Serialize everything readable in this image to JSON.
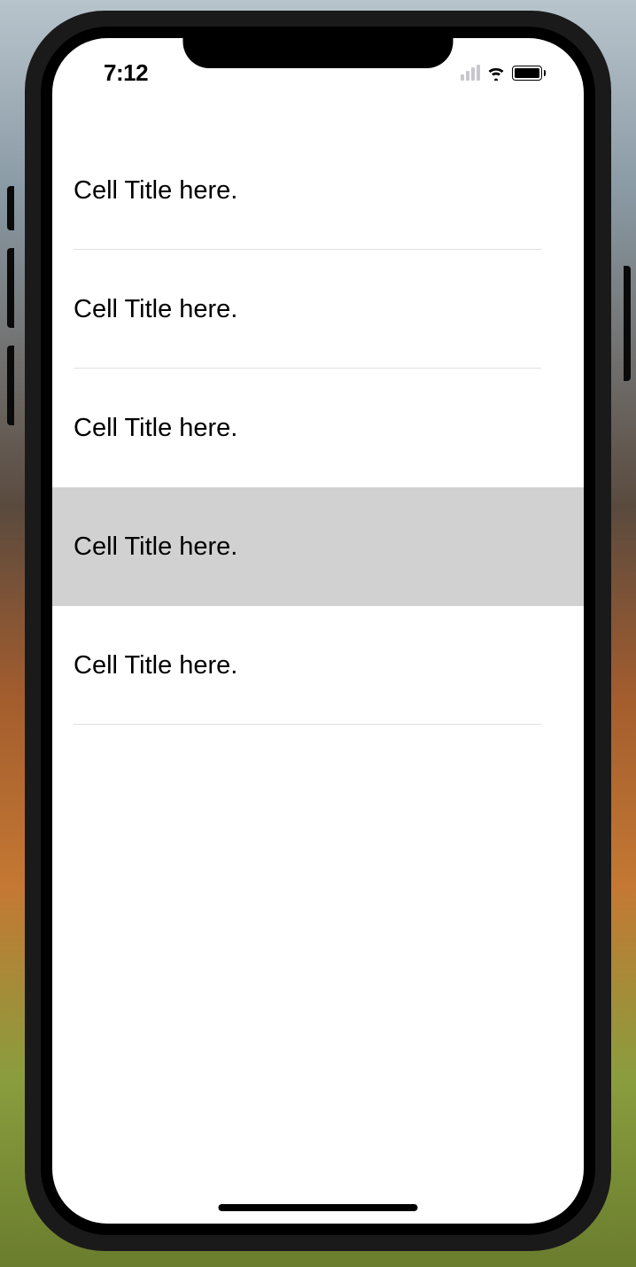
{
  "status_bar": {
    "time": "7:12"
  },
  "table": {
    "cells": [
      {
        "title": "Cell Title here.",
        "selected": false
      },
      {
        "title": "Cell Title here.",
        "selected": false
      },
      {
        "title": "Cell Title here.",
        "selected": false
      },
      {
        "title": "Cell Title here.",
        "selected": true
      },
      {
        "title": "Cell Title here.",
        "selected": false
      }
    ]
  }
}
